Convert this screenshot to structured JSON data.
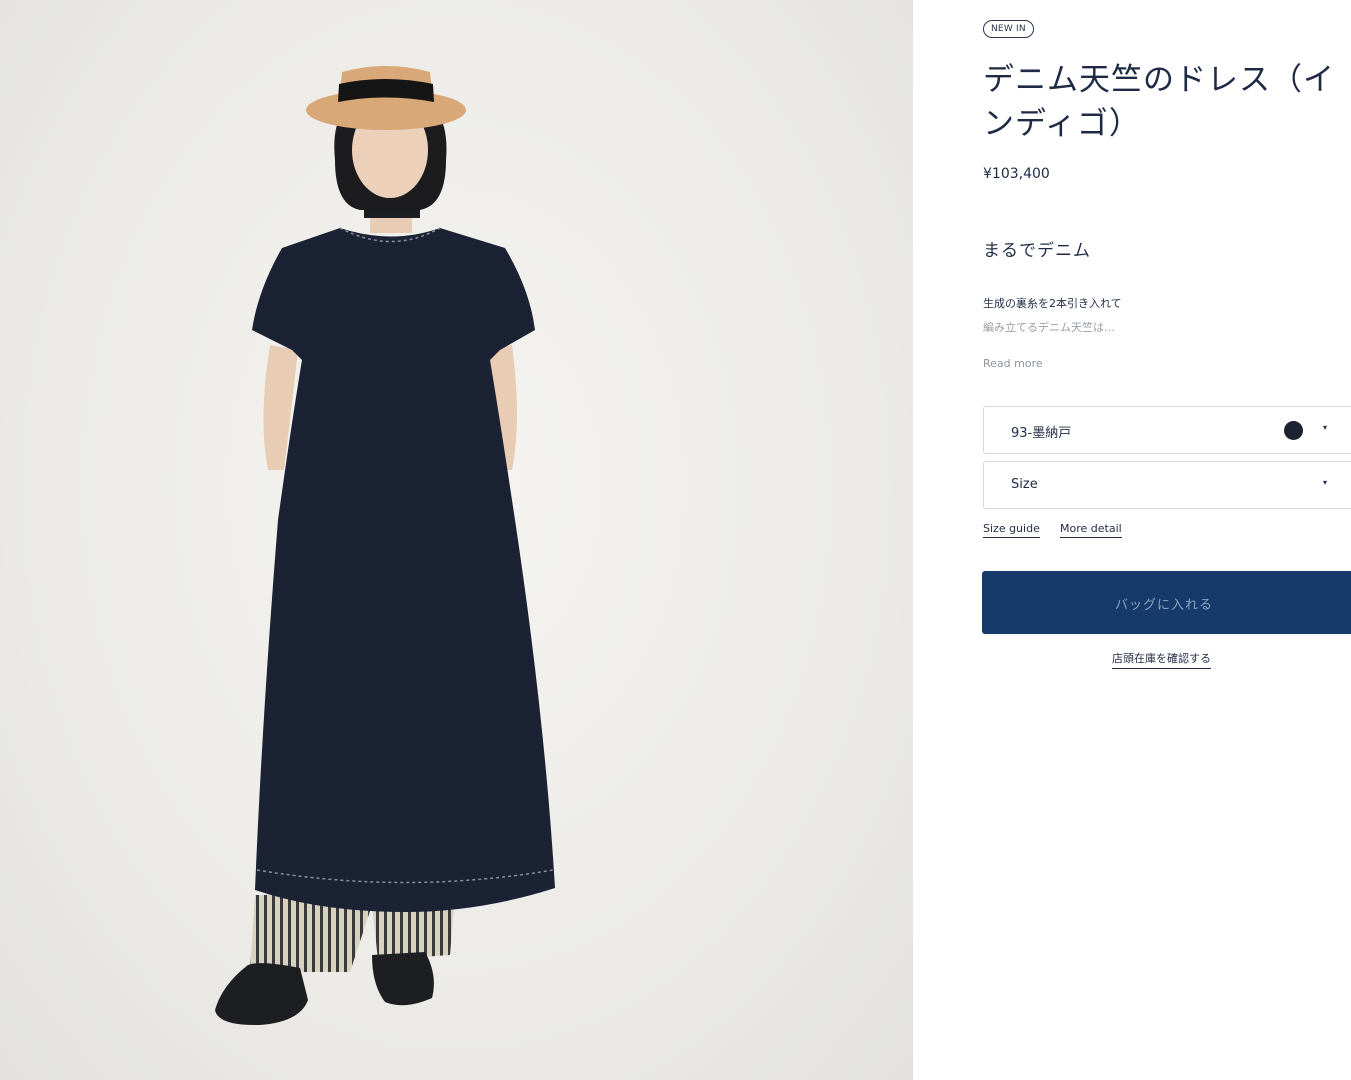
{
  "product": {
    "badge": "NEW IN",
    "title": "デニム天竺のドレス（インディゴ）",
    "price": "¥103,400",
    "subtitle": "まるでデニム",
    "description_line1": "生成の裏糸を2本引き入れて",
    "description_line2": "編み立てるデニム天竺は…",
    "read_more": "Read more"
  },
  "options": {
    "color_value": "93-墨納戸",
    "color_swatch": "#1d2230",
    "size_placeholder": "Size",
    "caret_icon": "▾"
  },
  "links": {
    "size_guide": "Size guide",
    "more_detail": "More detail"
  },
  "actions": {
    "add_to_bag": "バッグに入れる",
    "check_store_stock": "店頭在庫を確認する"
  },
  "colors": {
    "accent": "#163b6a",
    "text": "#1f2a44"
  }
}
